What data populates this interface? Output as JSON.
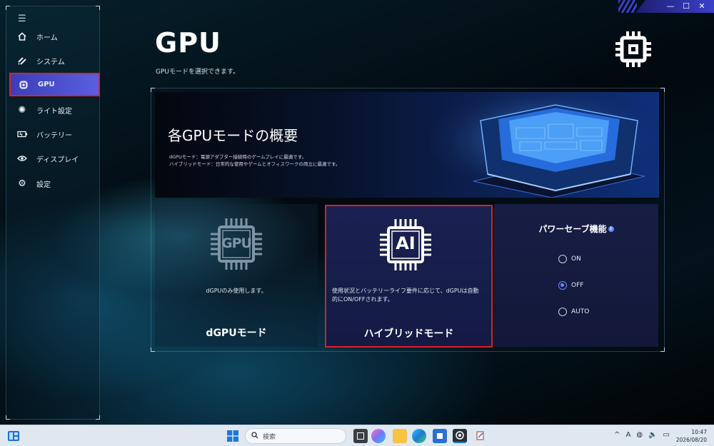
{
  "window": {
    "controls": [
      "—",
      "☐",
      "✕"
    ]
  },
  "sidebar": {
    "menu_icon": "hamburger-icon",
    "items": [
      {
        "label": "ホーム",
        "icon": "home-icon"
      },
      {
        "label": "システム",
        "icon": "system-icon"
      },
      {
        "label": "GPU",
        "icon": "chip-icon",
        "active": true
      },
      {
        "label": "ライト設定",
        "icon": "light-icon"
      },
      {
        "label": "バッテリー",
        "icon": "battery-icon"
      },
      {
        "label": "ディスプレイ",
        "icon": "display-icon"
      },
      {
        "label": "設定",
        "icon": "gear-icon"
      }
    ]
  },
  "header": {
    "title": "GPU",
    "subtitle": "GPUモードを選択できます。"
  },
  "banner": {
    "title": "各GPUモードの概要",
    "lines": [
      "dGPUモード：電源アダプター接続時のゲームプレイに最適です。",
      "ハイブリッドモード：日常的な使用やゲームとオフィスワークの両立に最適です。"
    ]
  },
  "modes": {
    "dgpu": {
      "chip_text": "GPU",
      "description": "dGPUのみ使用します。",
      "label": "dGPUモード"
    },
    "hybrid": {
      "chip_text": "AI",
      "description": "使用状況とバッテリーライフ要件に応じて、dGPUは自動的にON/OFFされます。",
      "label": "ハイブリッドモード",
      "selected": true
    }
  },
  "power_save": {
    "title": "パワーセーブ機能",
    "info_icon": "i",
    "options": [
      {
        "label": "ON",
        "checked": false
      },
      {
        "label": "OFF",
        "checked": true
      },
      {
        "label": "AUTO",
        "checked": false
      }
    ]
  },
  "taskbar": {
    "search_placeholder": "検索",
    "tray": [
      "^",
      "A",
      "◍",
      "🔈",
      "▭"
    ],
    "time": "10:47",
    "date": "2026/08/20"
  },
  "colors": {
    "accent": "#4a4fd0",
    "highlight_border": "#d7202a",
    "radio_checked": "#6b8cff"
  }
}
